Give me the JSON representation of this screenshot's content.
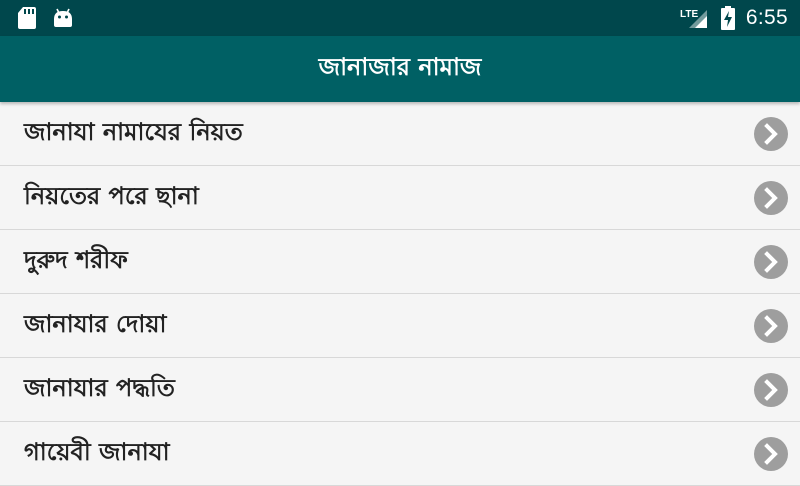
{
  "status_bar": {
    "network_label": "LTE",
    "time": "6:55",
    "icons": [
      "sd-card-icon",
      "android-icon",
      "lte-signal-icon",
      "battery-charging-icon"
    ]
  },
  "app_bar": {
    "title": "জানাজার নামাজ"
  },
  "list": {
    "items": [
      {
        "label": "জানাযা নামাযের নিয়ত"
      },
      {
        "label": "নিয়তের পরে ছানা"
      },
      {
        "label": "দুরুদ শরীফ"
      },
      {
        "label": "জানাযার দোয়া"
      },
      {
        "label": "জানাযার পদ্ধতি"
      },
      {
        "label": "গায়েবী জানাযা"
      }
    ],
    "chevron_icon": "chevron-right-circle-icon"
  },
  "colors": {
    "status_bar": "#00474c",
    "app_bar": "#006064",
    "list_background": "#f5f5f5",
    "chevron": "#9e9e9e"
  }
}
